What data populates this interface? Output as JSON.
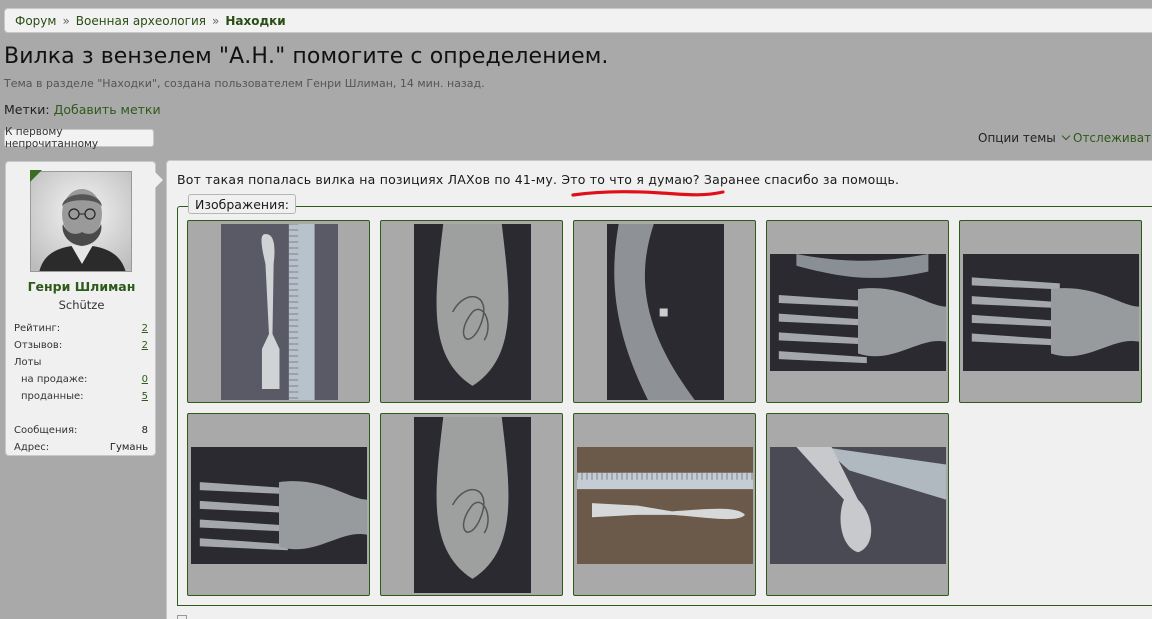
{
  "breadcrumb": {
    "items": [
      "Форум",
      "Военная археология"
    ],
    "current": "Находки",
    "sep": "»"
  },
  "thread": {
    "title": "Вилка з вензелем \"А.Н.\" помогите с определением.",
    "description": "Тема в разделе \"Находки\", создана пользователем Генри Шлиман, 14 мин. назад.",
    "tags_label": "Метки:",
    "tags_add": "Добавить метки",
    "unread_button": "К первому непрочитанному",
    "options_label": "Опции темы",
    "watch_label": "Отслеживать тему"
  },
  "user": {
    "name": "Генри Шлиман",
    "title": "Schütze",
    "stats": [
      {
        "label": "Рейтинг:",
        "value": "2",
        "link": true,
        "indent": false
      },
      {
        "label": "Отзывов:",
        "value": "2",
        "link": true,
        "indent": false
      },
      {
        "label": "Лоты",
        "value": "",
        "link": false,
        "indent": false
      },
      {
        "label": "на продаже:",
        "value": "0",
        "link": true,
        "indent": true
      },
      {
        "label": "проданные:",
        "value": "5",
        "link": true,
        "indent": true
      },
      {
        "label": "",
        "value": "",
        "link": false,
        "indent": false
      },
      {
        "label": "Сообщения:",
        "value": "8",
        "link": false,
        "indent": false
      },
      {
        "label": "Адрес:",
        "value": "Гумань",
        "link": false,
        "indent": false
      }
    ]
  },
  "post": {
    "text_before": "Вот такая попалась вилка на позициях ЛАХов по 41-му. ",
    "text_highlight": "Это то что я думаю?",
    "text_after": " Заранее спасибо за помощь.",
    "attachments_label": "Изображения:",
    "images": [
      {
        "name": "fork-with-ruler-vertical"
      },
      {
        "name": "fork-handle-monogram"
      },
      {
        "name": "fork-side-hallmark"
      },
      {
        "name": "fork-tines-closeup"
      },
      {
        "name": "fork-tines-angle"
      },
      {
        "name": "fork-tines-mark"
      },
      {
        "name": "fork-handle-monogram-2"
      },
      {
        "name": "fork-with-ruler-horizontal"
      },
      {
        "name": "fork-on-ruler-diagonal"
      }
    ]
  },
  "colors": {
    "link_green": "#2e5a1a",
    "underline_red": "#e0101a",
    "bg": "#a9a9a9"
  }
}
